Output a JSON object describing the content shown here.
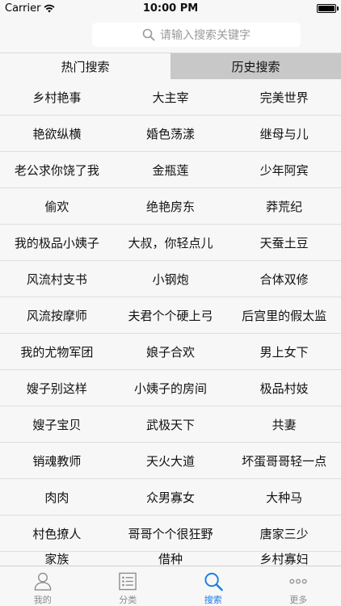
{
  "status_bar": {
    "carrier": "Carrier",
    "time": "10:00 PM"
  },
  "search": {
    "placeholder": "请输入搜索关键字"
  },
  "tabs": [
    {
      "label": "热门搜索",
      "active": true
    },
    {
      "label": "历史搜索",
      "active": false
    }
  ],
  "rows": [
    [
      "乡村艳事",
      "大主宰",
      "完美世界"
    ],
    [
      "艳欲纵横",
      "婚色荡漾",
      "继母与儿"
    ],
    [
      "老公求你饶了我",
      "金瓶莲",
      "少年阿宾"
    ],
    [
      "偷欢",
      "绝艳房东",
      "莽荒纪"
    ],
    [
      "我的极品小姨子",
      "大叔，你轻点儿",
      "天蚕土豆"
    ],
    [
      "风流村支书",
      "小钢炮",
      "合体双修"
    ],
    [
      "风流按摩师",
      "夫君个个硬上弓",
      "后宫里的假太监"
    ],
    [
      "我的尤物军团",
      "娘子合欢",
      "男上女下"
    ],
    [
      "嫂子别这样",
      "小姨子的房间",
      "极品村妓"
    ],
    [
      "嫂子宝贝",
      "武极天下",
      "共妻"
    ],
    [
      "销魂教师",
      "天火大道",
      "坏蛋哥哥轻一点"
    ],
    [
      "肉肉",
      "众男寡女",
      "大种马"
    ],
    [
      "村色撩人",
      "哥哥个个很狂野",
      "唐家三少"
    ],
    [
      "家族",
      "借种",
      "乡村寡妇"
    ]
  ],
  "tabbar": [
    {
      "label": "我的",
      "icon": "person-icon",
      "active": false
    },
    {
      "label": "分类",
      "icon": "list-icon",
      "active": false
    },
    {
      "label": "搜索",
      "icon": "search-icon",
      "active": true
    },
    {
      "label": "更多",
      "icon": "more-icon",
      "active": false
    }
  ],
  "colors": {
    "accent": "#1a7fe6",
    "inactive_tab": "#c8c8c8"
  }
}
